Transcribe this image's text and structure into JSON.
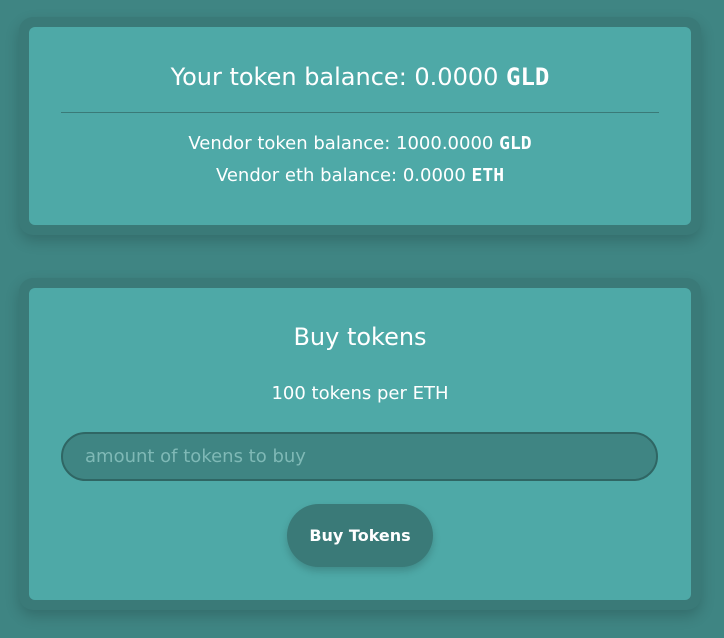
{
  "balance_card": {
    "your_balance_label": "Your token balance: ",
    "your_balance_value": "0.0000",
    "your_balance_unit": "GLD",
    "vendor_token_label": "Vendor token balance: ",
    "vendor_token_value": "1000.0000",
    "vendor_token_unit": "GLD",
    "vendor_eth_label": "Vendor eth balance: ",
    "vendor_eth_value": "0.0000",
    "vendor_eth_unit": "ETH"
  },
  "buy_card": {
    "title": "Buy tokens",
    "rate": "100 tokens per ETH",
    "input_value": "",
    "input_placeholder": "amount of tokens to buy",
    "button_label": "Buy Tokens"
  }
}
